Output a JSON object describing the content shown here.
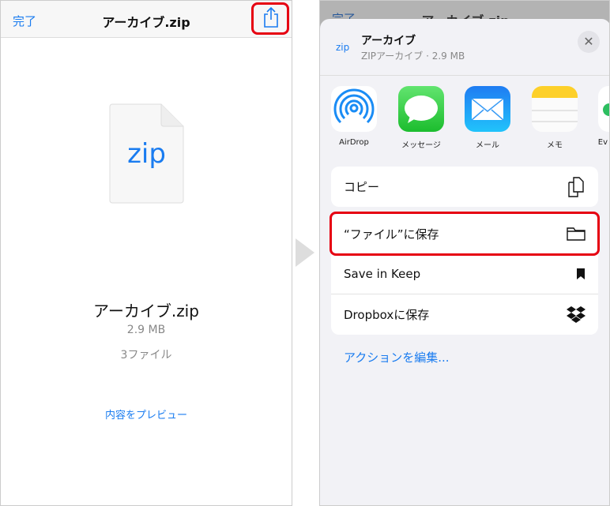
{
  "left": {
    "done": "完了",
    "title": "アーカイブ.zip",
    "file_icon_label": "zip",
    "file_name": "アーカイブ.zip",
    "file_size": "2.9 MB",
    "file_count": "3ファイル",
    "preview_link": "内容をプレビュー"
  },
  "right": {
    "bg_done": "完了",
    "bg_title": "アーカイブ.zip",
    "sheet": {
      "icon_label": "zip",
      "title": "アーカイブ",
      "subtitle": "ZIPアーカイブ · 2.9 MB",
      "apps": [
        {
          "label": "AirDrop",
          "icon": "airdrop-icon"
        },
        {
          "label": "メッセージ",
          "icon": "messages-icon"
        },
        {
          "label": "メール",
          "icon": "mail-icon"
        },
        {
          "label": "メモ",
          "icon": "notes-icon"
        },
        {
          "label": "Ev",
          "icon": "evernote-icon"
        }
      ],
      "actions1": [
        {
          "label": "コピー",
          "icon": "copy-icon"
        }
      ],
      "actions2": [
        {
          "label": "“ファイル”に保存",
          "icon": "folder-icon"
        },
        {
          "label": "Save in Keep",
          "icon": "bookmark-icon"
        },
        {
          "label": "Dropboxに保存",
          "icon": "dropbox-icon"
        }
      ],
      "edit_actions": "アクションを編集..."
    }
  },
  "colors": {
    "accent": "#1a7cf0",
    "highlight": "#e60012"
  }
}
